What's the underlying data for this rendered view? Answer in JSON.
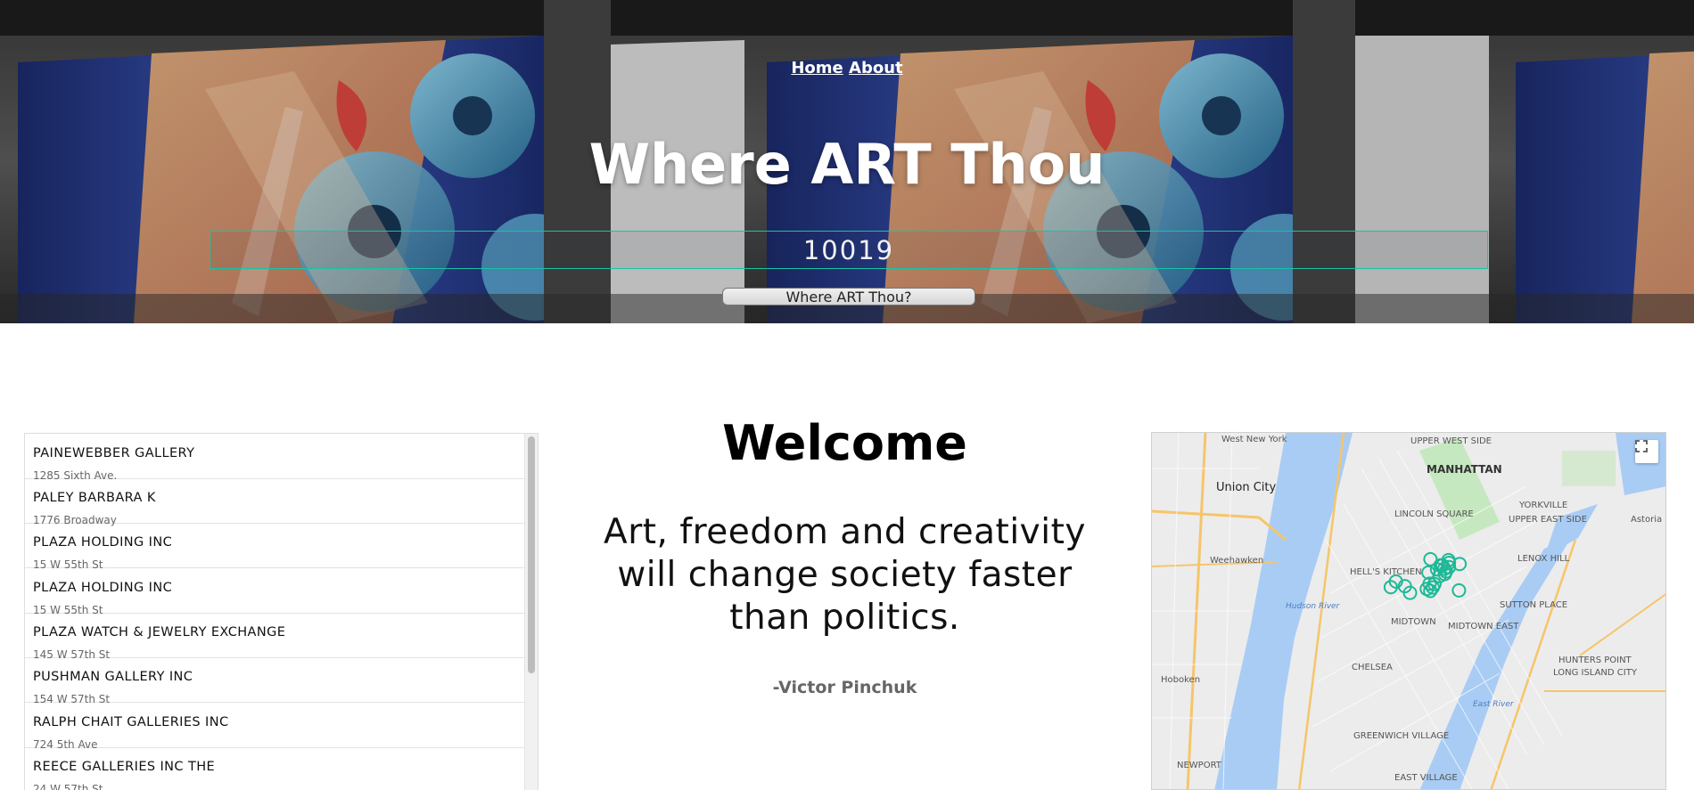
{
  "nav": {
    "home": "Home",
    "about": "About"
  },
  "hero": {
    "title": "Where ART Thou",
    "zip_value": "10019",
    "button_label": "Where ART Thou?"
  },
  "galleries": [
    {
      "name": "PAINEWEBBER GALLERY",
      "address": "1285 Sixth Ave."
    },
    {
      "name": "PALEY BARBARA K",
      "address": "1776 Broadway"
    },
    {
      "name": "PLAZA HOLDING INC",
      "address": "15 W 55th St"
    },
    {
      "name": "PLAZA HOLDING INC",
      "address": "15 W 55th St"
    },
    {
      "name": "PLAZA WATCH & JEWELRY EXCHANGE",
      "address": "145 W 57th St"
    },
    {
      "name": "PUSHMAN GALLERY INC",
      "address": "154 W 57th St"
    },
    {
      "name": "RALPH CHAIT GALLERIES INC",
      "address": "724 5th Ave"
    },
    {
      "name": "REECE GALLERIES INC THE",
      "address": "24 W 57th St"
    }
  ],
  "welcome": {
    "title": "Welcome",
    "quote": "Art, freedom and creativity will change society faster than politics.",
    "author": "-Victor Pinchuk"
  },
  "map": {
    "labels": {
      "west_new_york": "West New York",
      "union_city": "Union City",
      "weehawken": "Weehawken",
      "hoboken": "Hoboken",
      "newport": "NEWPORT",
      "manhattan": "MANHATTAN",
      "upper_west_side": "UPPER WEST SIDE",
      "lincoln_square": "LINCOLN SQUARE",
      "hells_kitchen": "HELL'S KITCHEN",
      "midtown": "MIDTOWN",
      "midtown_east": "MIDTOWN EAST",
      "chelsea": "CHELSEA",
      "greenwich_village": "GREENWICH VILLAGE",
      "east_village": "EAST VILLAGE",
      "yorkville": "YORKVILLE",
      "upper_east_side": "UPPER EAST SIDE",
      "lenox_hill": "LENOX HILL",
      "sutton_place": "SUTTON PLACE",
      "hunters_point": "HUNTERS POINT",
      "long_island_city": "LONG ISLAND CITY",
      "astoria": "Astoria",
      "hudson_river": "Hudson River",
      "east_river": "East River"
    },
    "colors": {
      "water": "#a9ccf4",
      "land": "#ececec",
      "park": "#c6e8c0",
      "marker": "#1fb897",
      "highway": "#f6c56a"
    },
    "marker_count": 24
  },
  "icons": {
    "fullscreen": "fullscreen-icon"
  }
}
